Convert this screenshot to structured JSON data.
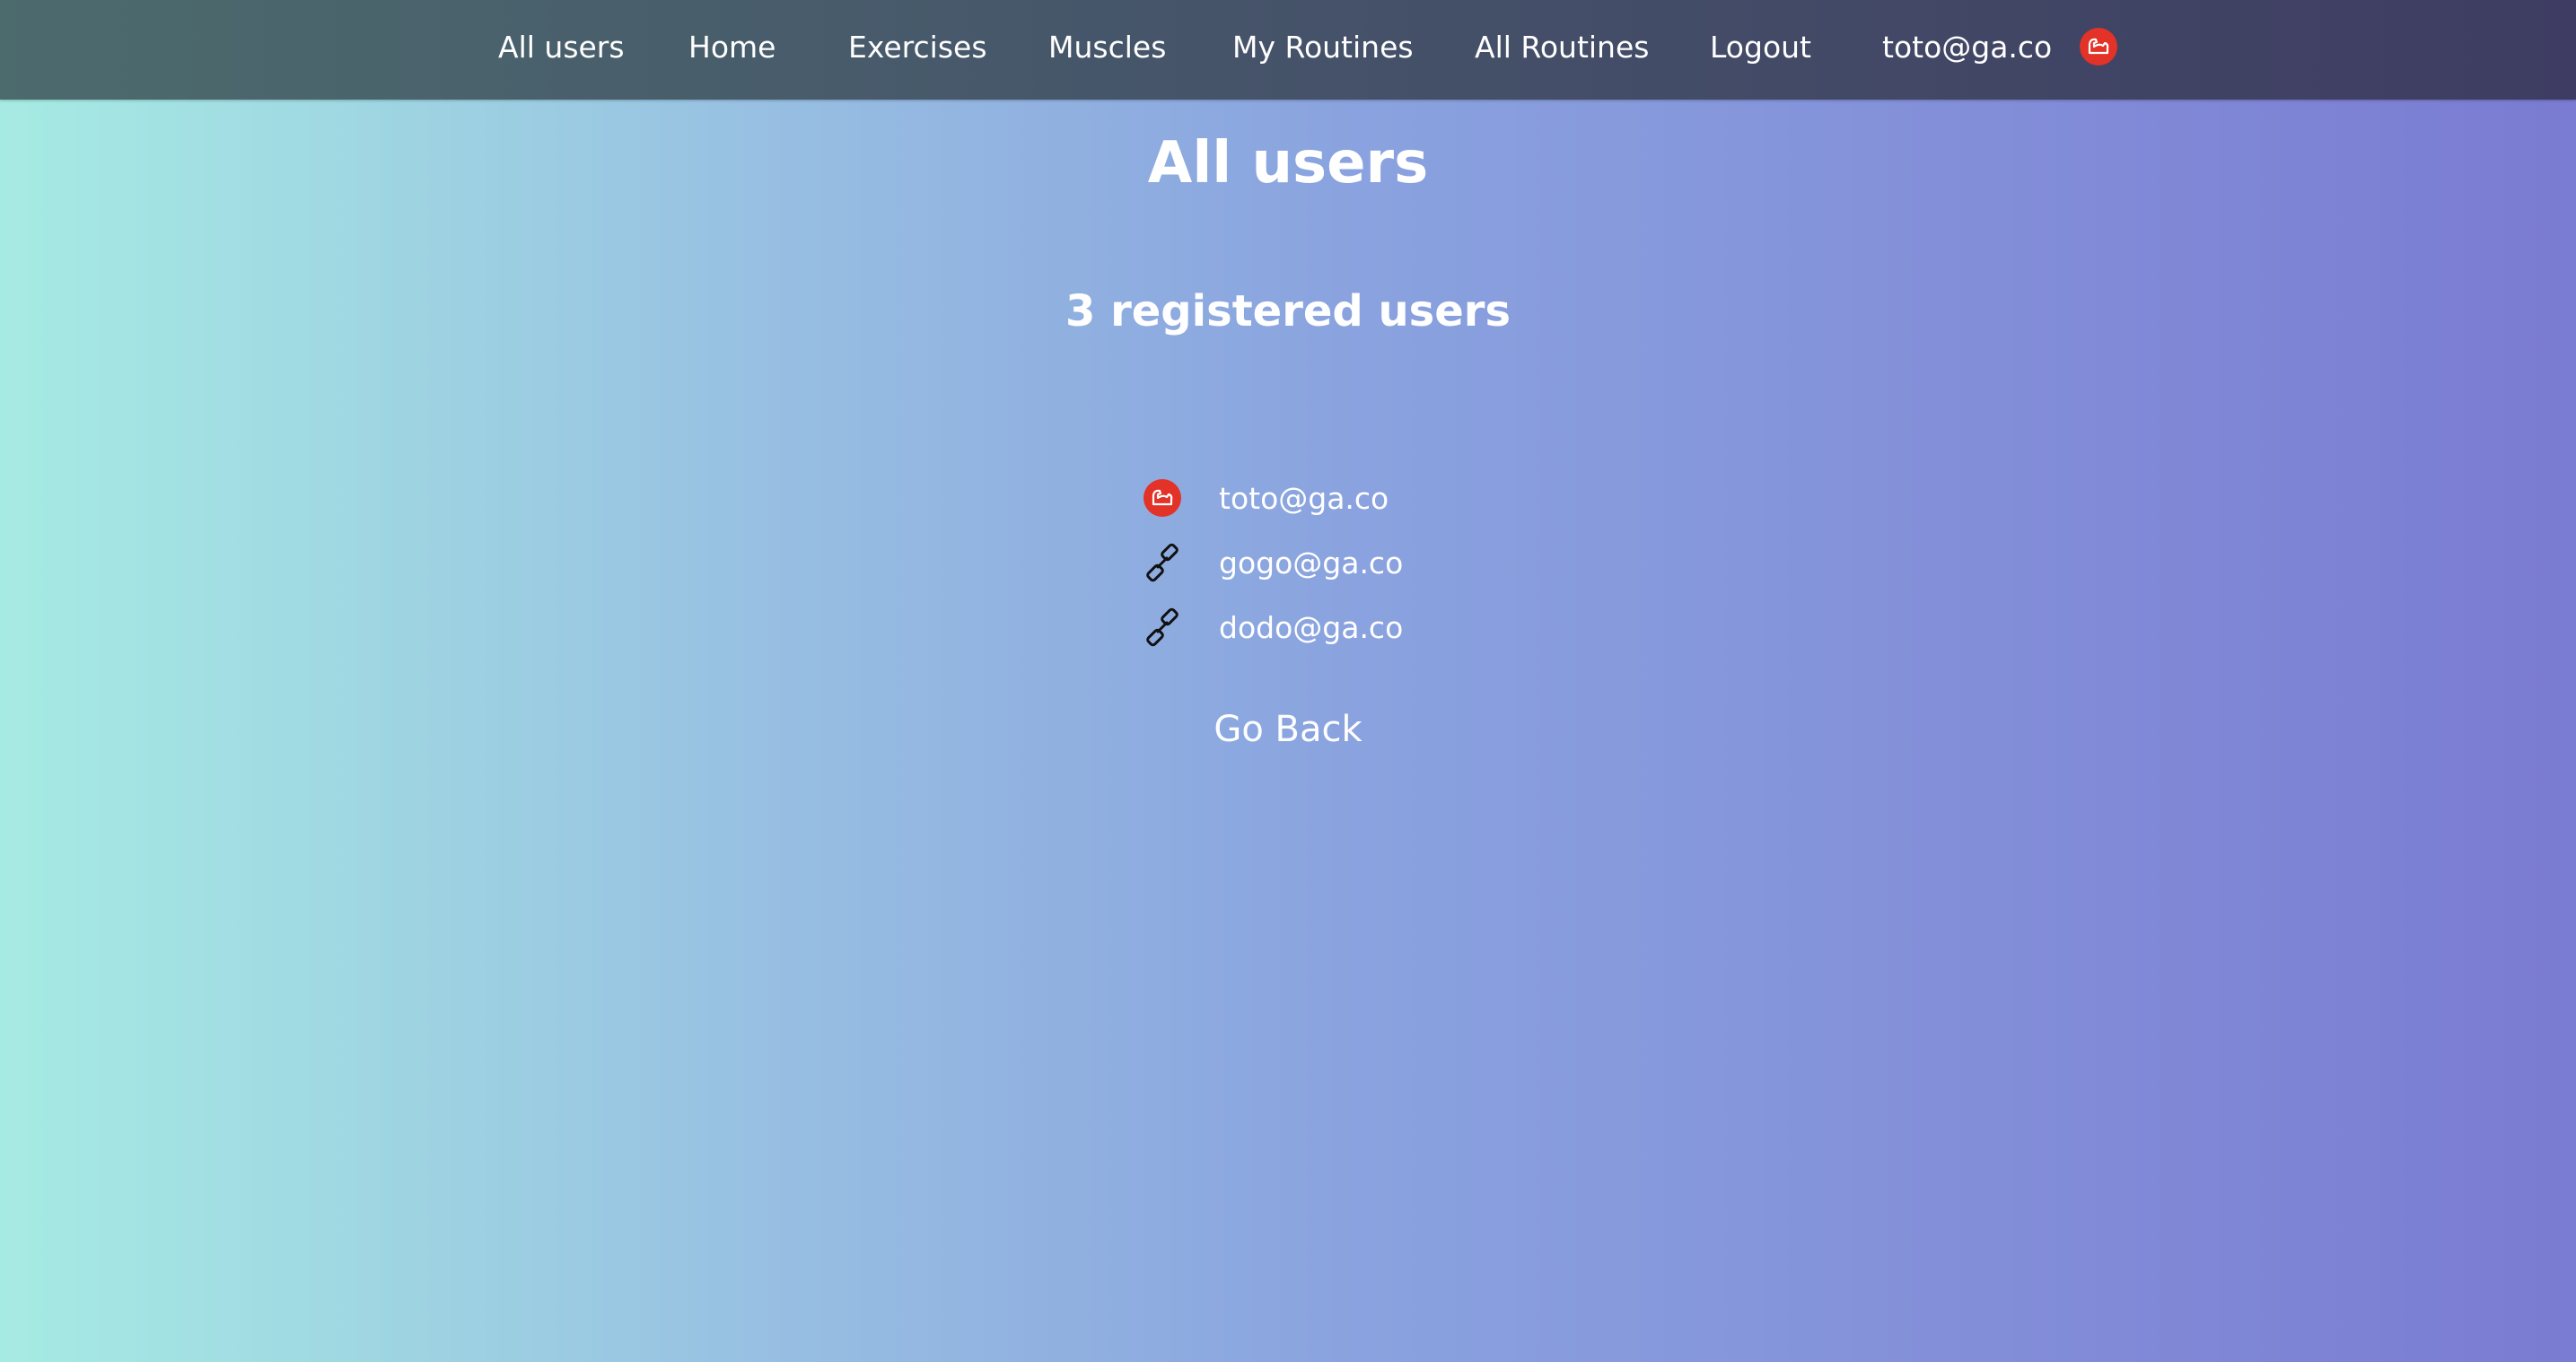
{
  "nav": {
    "items": [
      {
        "label": "All users"
      },
      {
        "label": "Home"
      },
      {
        "label": "Exercises"
      },
      {
        "label": "Muscles"
      },
      {
        "label": "My Routines"
      },
      {
        "label": "All Routines"
      },
      {
        "label": "Logout"
      },
      {
        "label": "toto@ga.co"
      }
    ],
    "avatar_icon": "flexed-arm-icon",
    "avatar_color": "#e33227"
  },
  "main": {
    "title": "All users",
    "count_heading": "3 registered users",
    "users": [
      {
        "email": "toto@ga.co",
        "icon": "flexed-arm-icon"
      },
      {
        "email": "gogo@ga.co",
        "icon": "dumbbell-icon"
      },
      {
        "email": "dodo@ga.co",
        "icon": "dumbbell-icon"
      }
    ],
    "back_label": "Go Back"
  }
}
